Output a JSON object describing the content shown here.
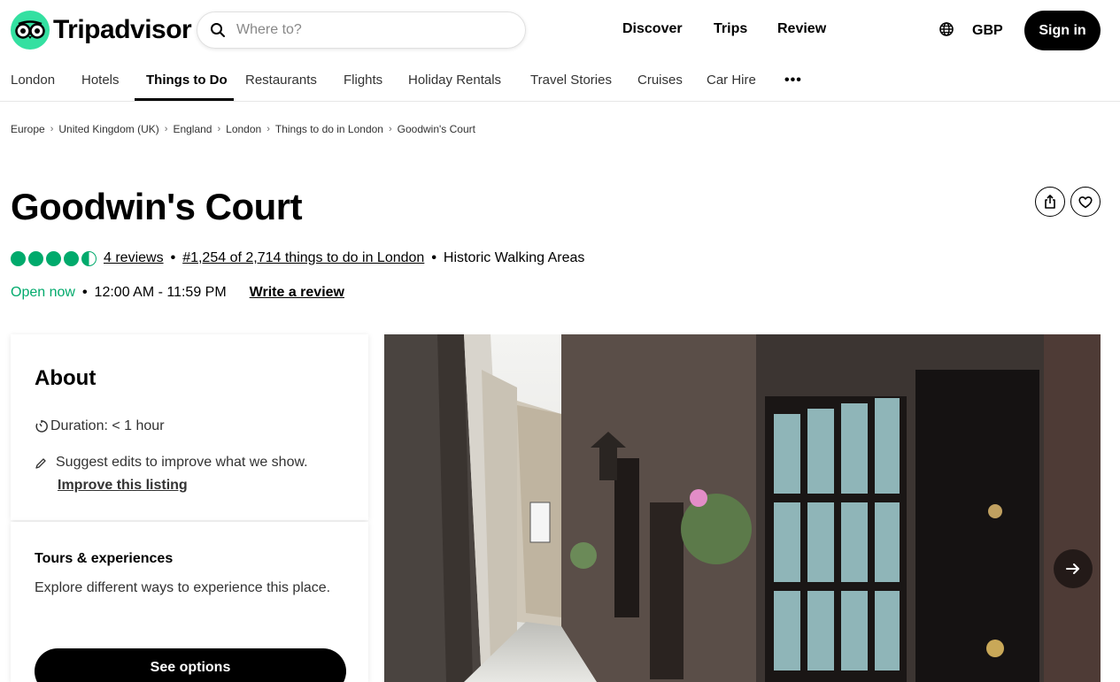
{
  "brand": {
    "name": "Tripadvisor",
    "accent": "#34e0a1",
    "rating_green": "#00aa6c"
  },
  "search": {
    "placeholder": "Where to?",
    "value": ""
  },
  "top_nav": [
    "Discover",
    "Trips",
    "Review"
  ],
  "currency": "GBP",
  "sign_in_label": "Sign in",
  "sub_nav": {
    "items": [
      "London",
      "Hotels",
      "Things to Do",
      "Restaurants",
      "Flights",
      "Holiday Rentals",
      "Travel Stories",
      "Cruises",
      "Car Hire"
    ],
    "active": "Things to Do",
    "more_label": "•••"
  },
  "breadcrumb": [
    "Europe",
    "United Kingdom (UK)",
    "England",
    "London",
    "Things to do in London",
    "Goodwin's Court"
  ],
  "title": "Goodwin's Court",
  "rating": {
    "value": 4.5,
    "reviews_label": "4 reviews",
    "rank_label": "#1,254 of 2,714 things to do in London",
    "category": "Historic Walking Areas"
  },
  "hours": {
    "status": "Open now",
    "range": "12:00 AM - 11:59 PM",
    "write_review_label": "Write a review"
  },
  "about": {
    "title": "About",
    "duration": "Duration: < 1 hour",
    "suggest_text": "Suggest edits to improve what we show.",
    "improve_label": "Improve this listing"
  },
  "tours": {
    "title": "Tours & experiences",
    "text": "Explore different ways to experience this place.",
    "button_label": "See options"
  },
  "icons": {
    "search": "search-icon",
    "globe": "globe-icon",
    "share": "share-icon",
    "heart": "heart-icon",
    "timer": "timer-icon",
    "pencil": "pencil-icon",
    "next": "arrow-right-icon"
  }
}
